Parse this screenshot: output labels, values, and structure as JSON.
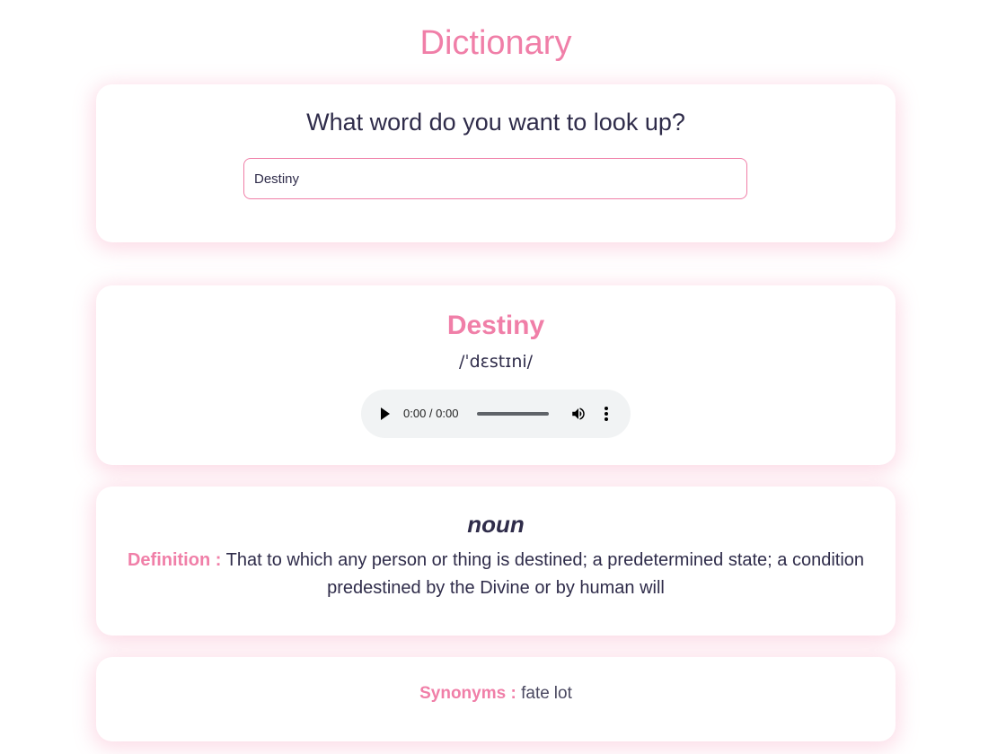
{
  "header": {
    "title": "Dictionary"
  },
  "search": {
    "heading": "What word do you want to look up?",
    "value": "Destiny",
    "placeholder": ""
  },
  "word": {
    "title": "Destiny",
    "phonetic": "/ˈdɛstɪni/"
  },
  "audio": {
    "time": "0:00 / 0:00",
    "play_icon": "play-icon",
    "volume_icon": "volume-icon",
    "menu_icon": "more-vert-icon"
  },
  "meanings": [
    {
      "part_of_speech": "noun",
      "definition_label": "Definition :",
      "definition": "That to which any person or thing is destined; a predetermined state; a condition predestined by the Divine or by human will"
    }
  ],
  "synonyms": {
    "label": "Synonyms :",
    "items": [
      "fate",
      "lot"
    ]
  },
  "colors": {
    "accent": "#f07fa8",
    "text": "#2f2c4a",
    "audio_bg": "#f1f3f4"
  }
}
